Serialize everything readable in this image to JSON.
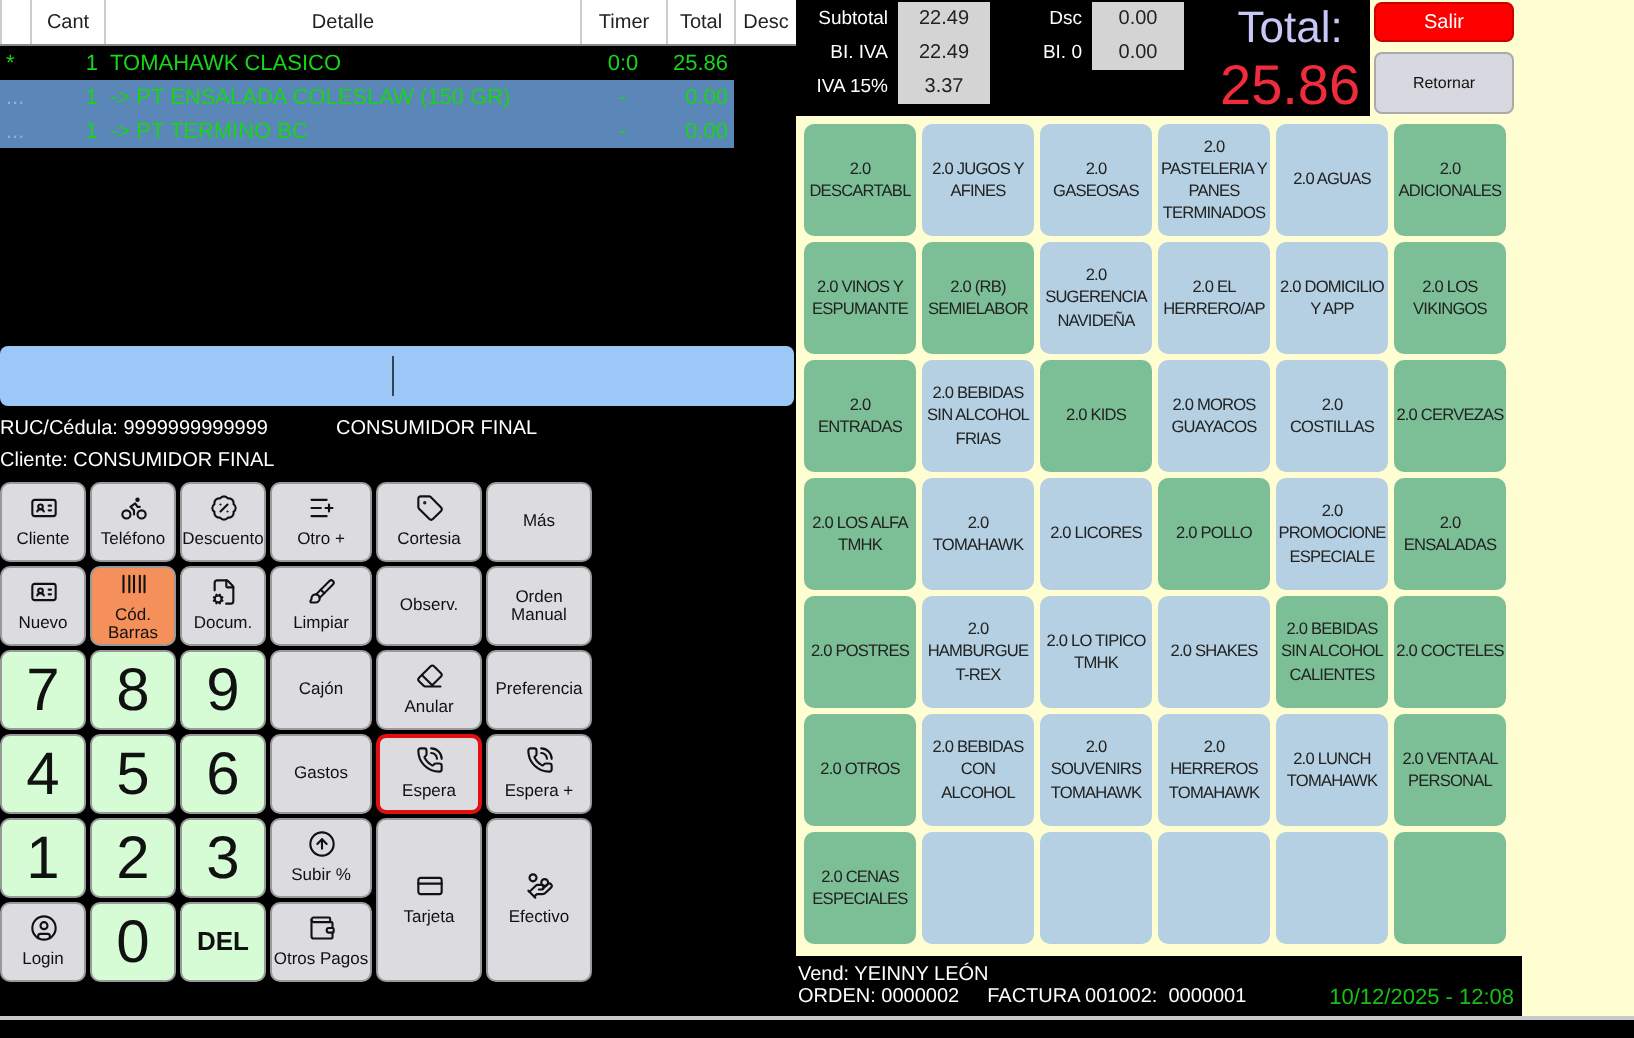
{
  "order_table": {
    "columns": [
      "Cant",
      "Detalle",
      "Timer",
      "Total",
      "Desc"
    ],
    "rows": [
      {
        "marker": "*",
        "cant": "1",
        "detalle": "TOMAHAWK CLASICO",
        "timer": "0:0",
        "total": "25.86",
        "selected": false
      },
      {
        "marker": "...",
        "cant": "1",
        "detalle": "-> PT ENSALADA COLESLAW (150 GR)",
        "timer": "-",
        "total": "0.00",
        "selected": true
      },
      {
        "marker": "...",
        "cant": "1",
        "detalle": "-> PT TERMINO BC",
        "timer": "-",
        "total": "0.00",
        "selected": true
      }
    ]
  },
  "totals": {
    "left": [
      {
        "label": "Subtotal",
        "value": "22.49"
      },
      {
        "label": "BI. IVA",
        "value": "22.49"
      },
      {
        "label": "IVA 15%",
        "value": "3.37"
      }
    ],
    "right": [
      {
        "label": "Dsc",
        "value": "0.00"
      },
      {
        "label": "BI. 0",
        "value": "0.00"
      }
    ],
    "total_label": "Total:",
    "total_value": "25.86"
  },
  "exit_button": "Salir",
  "return_button": "Retornar",
  "customer": {
    "ruc": "RUC/Cédula: 9999999999999",
    "name": "CONSUMIDOR FINAL",
    "client": "Cliente: CONSUMIDOR FINAL"
  },
  "keypad": [
    {
      "label": "Cliente",
      "kind": "action",
      "selected": false
    },
    {
      "label": "Teléfono",
      "kind": "action",
      "selected": false
    },
    {
      "label": "Descuento",
      "kind": "action",
      "selected": false
    },
    {
      "label": "Otro +",
      "kind": "action",
      "selected": false
    },
    {
      "label": "Cortesia",
      "kind": "action",
      "selected": false
    },
    {
      "label": "Más",
      "kind": "action",
      "selected": false
    },
    {
      "label": "Nuevo",
      "kind": "action",
      "selected": false
    },
    {
      "label": "Cód. Barras",
      "kind": "accent",
      "selected": false
    },
    {
      "label": "Docum.",
      "kind": "action",
      "selected": false
    },
    {
      "label": "Limpiar",
      "kind": "action",
      "selected": false
    },
    {
      "label": "Observ.",
      "kind": "action",
      "selected": false
    },
    {
      "label": "Orden Manual",
      "kind": "action",
      "selected": false
    },
    {
      "label": "7",
      "kind": "digit",
      "selected": false
    },
    {
      "label": "8",
      "kind": "digit",
      "selected": false
    },
    {
      "label": "9",
      "kind": "digit",
      "selected": false
    },
    {
      "label": "Cajón",
      "kind": "action",
      "selected": false
    },
    {
      "label": "Anular",
      "kind": "action",
      "selected": false
    },
    {
      "label": "Preferencia",
      "kind": "action",
      "selected": false
    },
    {
      "label": "4",
      "kind": "digit",
      "selected": false
    },
    {
      "label": "5",
      "kind": "digit",
      "selected": false
    },
    {
      "label": "6",
      "kind": "digit",
      "selected": false
    },
    {
      "label": "Gastos",
      "kind": "action",
      "selected": false
    },
    {
      "label": "Espera",
      "kind": "action",
      "selected": true
    },
    {
      "label": "Espera +",
      "kind": "action",
      "selected": false
    },
    {
      "label": "1",
      "kind": "digit",
      "selected": false
    },
    {
      "label": "2",
      "kind": "digit",
      "selected": false
    },
    {
      "label": "3",
      "kind": "digit",
      "selected": false
    },
    {
      "label": "Subir %",
      "kind": "action",
      "selected": false
    },
    {
      "label": "Tarjeta",
      "kind": "tall",
      "selected": false
    },
    {
      "label": "Efectivo",
      "kind": "tall",
      "selected": false
    },
    {
      "label": "Login",
      "kind": "action",
      "selected": false
    },
    {
      "label": "0",
      "kind": "digit",
      "selected": false
    },
    {
      "label": "DEL",
      "kind": "delete",
      "selected": false
    },
    {
      "label": "Otros Pagos",
      "kind": "action",
      "selected": false
    }
  ],
  "categories": [
    {
      "label": "2.0 DESCARTABL",
      "color": "#7cbf96"
    },
    {
      "label": "2.0 JUGOS Y AFINES",
      "color": "#b4d0e2"
    },
    {
      "label": "2.0 GASEOSAS",
      "color": "#b4d0e2"
    },
    {
      "label": "2.0 PASTELERIA Y PANES TERMINADOS",
      "color": "#b4d0e2"
    },
    {
      "label": "2.0 AGUAS",
      "color": "#b4d0e2"
    },
    {
      "label": "2.0 ADICIONALES",
      "color": "#7cbf96"
    },
    {
      "label": "2.0 VINOS Y ESPUMANTE",
      "color": "#7cbf96"
    },
    {
      "label": "2.0 (RB) SEMIELABOR",
      "color": "#7cbf96"
    },
    {
      "label": "2.0 SUGERENCIA NAVIDEÑA",
      "color": "#b4d0e2"
    },
    {
      "label": "2.0 EL HERRERO/AP",
      "color": "#b4d0e2"
    },
    {
      "label": "2.0 DOMICILIO Y APP",
      "color": "#b4d0e2"
    },
    {
      "label": "2.0 LOS VIKINGOS",
      "color": "#7cbf96"
    },
    {
      "label": "2.0 ENTRADAS",
      "color": "#7cbf96"
    },
    {
      "label": "2.0 BEBIDAS SIN ALCOHOL FRIAS",
      "color": "#b4d0e2"
    },
    {
      "label": "2.0 KIDS",
      "color": "#7cbf96"
    },
    {
      "label": "2.0 MOROS GUAYACOS",
      "color": "#b4d0e2"
    },
    {
      "label": "2.0 COSTILLAS",
      "color": "#b4d0e2"
    },
    {
      "label": "2.0 CERVEZAS",
      "color": "#7cbf96"
    },
    {
      "label": "2.0 LOS ALFA TMHK",
      "color": "#7cbf96"
    },
    {
      "label": "2.0 TOMAHAWK",
      "color": "#b4d0e2"
    },
    {
      "label": "2.0 LICORES",
      "color": "#b4d0e2"
    },
    {
      "label": "2.0 POLLO",
      "color": "#7cbf96"
    },
    {
      "label": "2.0 PROMOCIONE ESPECIALE",
      "color": "#b4d0e2"
    },
    {
      "label": "2.0 ENSALADAS",
      "color": "#7cbf96"
    },
    {
      "label": "2.0 POSTRES",
      "color": "#7cbf96"
    },
    {
      "label": "2.0 HAMBURGUE T-REX",
      "color": "#b4d0e2"
    },
    {
      "label": "2.0 LO TIPICO TMHK",
      "color": "#b4d0e2"
    },
    {
      "label": "2.0 SHAKES",
      "color": "#b4d0e2"
    },
    {
      "label": "2.0 BEBIDAS SIN ALCOHOL CALIENTES",
      "color": "#7cbf96"
    },
    {
      "label": "2.0 COCTELES",
      "color": "#7cbf96"
    },
    {
      "label": "2.0 OTROS",
      "color": "#7cbf96"
    },
    {
      "label": "2.0 BEBIDAS CON ALCOHOL",
      "color": "#b4d0e2"
    },
    {
      "label": "2.0 SOUVENIRS TOMAHAWK",
      "color": "#b4d0e2"
    },
    {
      "label": "2.0 HERREROS TOMAHAWK",
      "color": "#b4d0e2"
    },
    {
      "label": "2.0 LUNCH TOMAHAWK",
      "color": "#b4d0e2"
    },
    {
      "label": "2.0 VENTA AL PERSONAL",
      "color": "#7cbf96"
    },
    {
      "label": "2.0 CENAS ESPECIALES",
      "color": "#7cbf96"
    },
    {
      "color": "#b4d0e2"
    },
    {
      "color": "#b4d0e2"
    },
    {
      "color": "#b4d0e2"
    },
    {
      "color": "#b4d0e2"
    },
    {
      "color": "#7cbf96"
    }
  ],
  "status_bar": {
    "vendor": "Vend: YEINNY LEÓN",
    "order": "ORDEN: 0000002",
    "invoice": "FACTURA 001002:  0000001",
    "datetime": "10/12/2025 - 12:08"
  }
}
